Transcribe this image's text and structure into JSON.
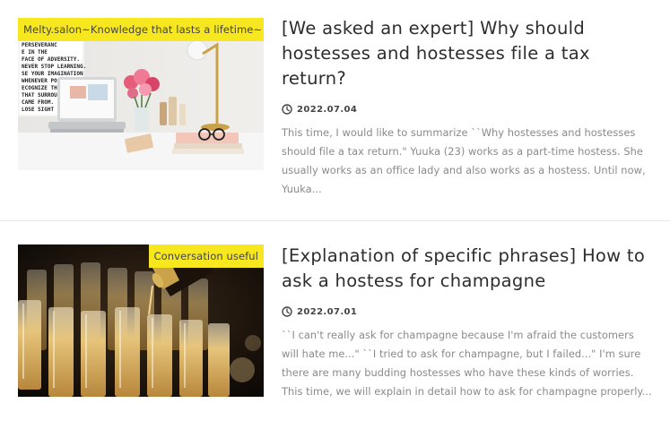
{
  "articles": [
    {
      "category": "Melty.salon~Knowledge that lasts a lifetime~",
      "title": "[We asked an expert] Why should hostesses and hostesses file a tax return?",
      "date": "2022.07.04",
      "excerpt": "This time, I would like to summarize ``Why hostesses and hostesses should file a tax return.\" Yuuka (23) works as a part-time hostess. She usually works as an office lady and also works as a hostess. Until now, Yuuka...",
      "image": "desk-laptop-flowers-photo",
      "poster_text": "PERSEVERANCE IN THE FACE OF ADVERSITY. NEVER STOP LEARNING. USE YOUR IMAGINATION WHENEVER POSSIBLE. RECOGNIZE THE AUTY THAT SURROUND ... WHEN SOMEBODY ... CAME FROM. BUT NEVER LOSE SIGHT OF WHO YOU ARE GO"
    },
    {
      "category": "Conversation useful",
      "title": "[Explanation of specific phrases] How to ask a hostess for champagne",
      "date": "2022.07.01",
      "excerpt": "``I can't really ask for champagne because I'm afraid the customers will hate me...\" ``I tried to ask for champagne, but I failed...\" I'm sure there are many budding hostesses who have these kinds of worries. This time, we will explain in detail how to ask for champagne properly...",
      "image": "champagne-glasses-photo"
    }
  ],
  "colors": {
    "badge": "#f7e71e",
    "title": "#2d2d2d",
    "excerpt": "#8a8a8a"
  }
}
